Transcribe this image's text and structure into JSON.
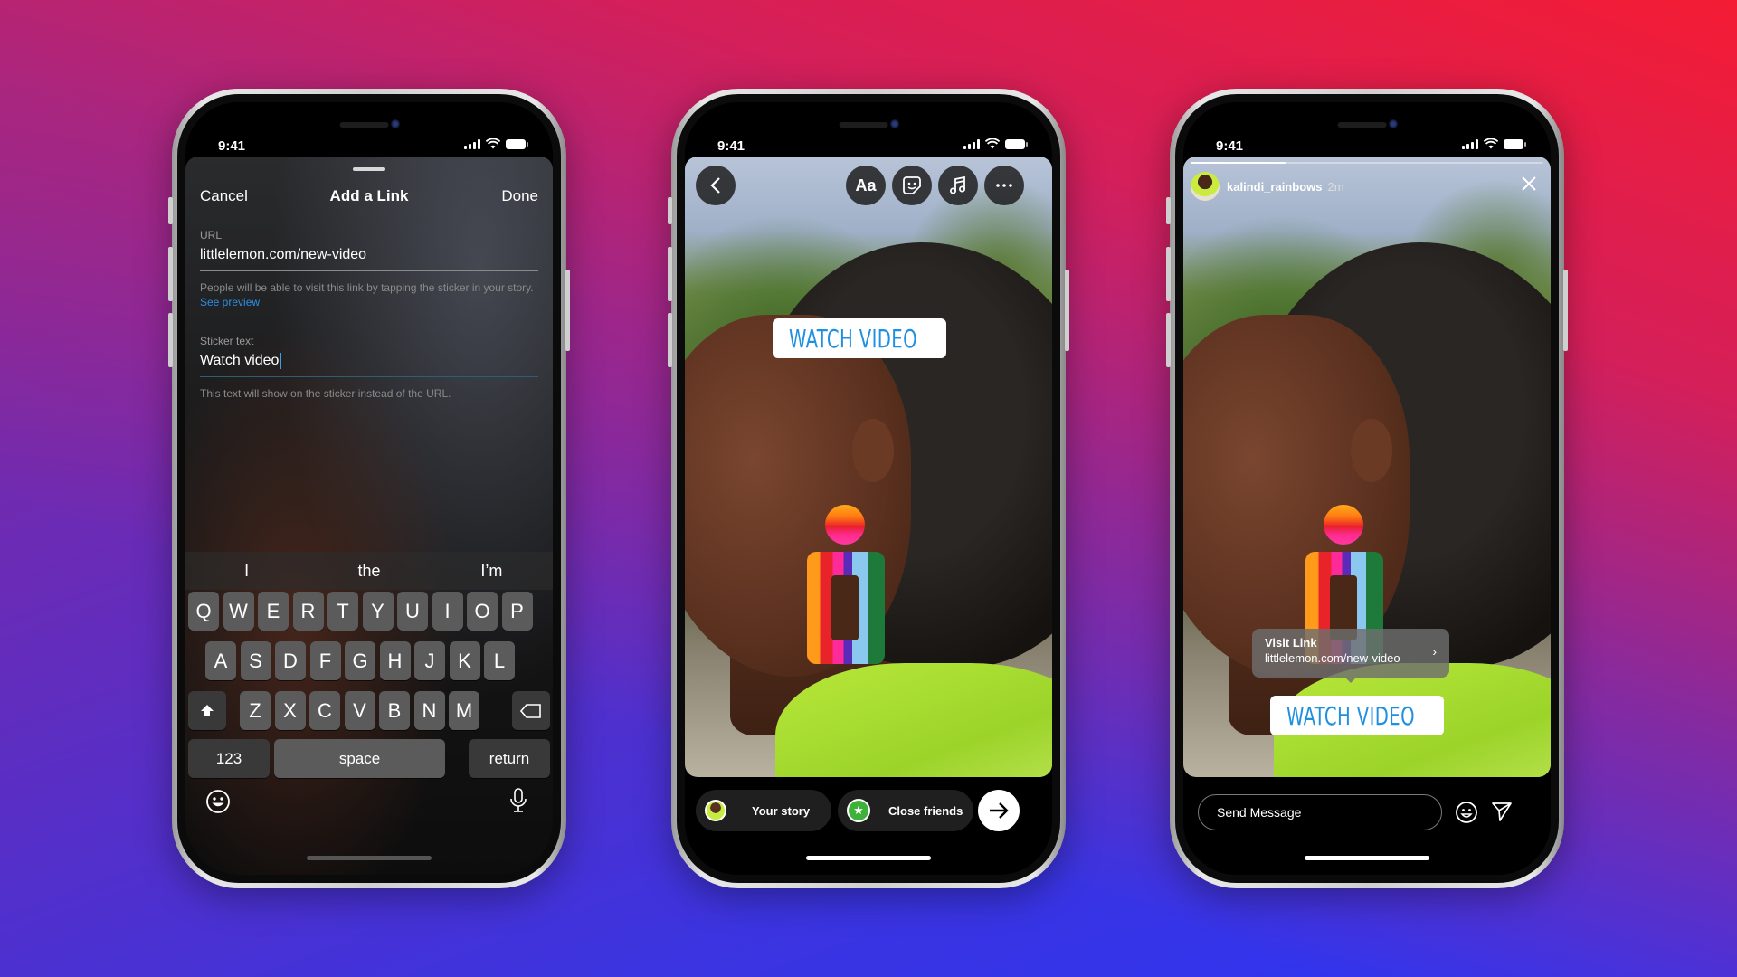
{
  "background": {
    "gradient_colors": [
      "#2c35f5",
      "#6b2bb5",
      "#d41f5a",
      "#f41c34"
    ]
  },
  "status_bar": {
    "time": "9:41"
  },
  "phone1": {
    "sheet": {
      "cancel_label": "Cancel",
      "title": "Add a Link",
      "done_label": "Done"
    },
    "url_field": {
      "label": "URL",
      "value": "littlelemon.com/new-video",
      "help_text": "People will be able to visit this link by tapping the sticker in your story.",
      "help_link": "See preview"
    },
    "sticker_field": {
      "label": "Sticker text",
      "value": "Watch video",
      "help_text": "This text will show on the sticker instead of the URL."
    },
    "suggestions": [
      "I",
      "the",
      "I’m"
    ],
    "keyboard": {
      "row1": [
        "Q",
        "W",
        "E",
        "R",
        "T",
        "Y",
        "U",
        "I",
        "O",
        "P"
      ],
      "row2": [
        "A",
        "S",
        "D",
        "F",
        "G",
        "H",
        "J",
        "K",
        "L"
      ],
      "row3": [
        "Z",
        "X",
        "C",
        "V",
        "B",
        "N",
        "M"
      ],
      "numbers_label": "123",
      "space_label": "space",
      "return_label": "return",
      "shift_icon": "shift-icon",
      "delete_icon": "backspace-icon",
      "emoji_icon": "emoji-icon",
      "mic_icon": "microphone-icon"
    }
  },
  "phone2": {
    "toolbar": {
      "back_icon": "chevron-left-icon",
      "text_label": "Aa",
      "sticker_icon": "sticker-icon",
      "music_icon": "music-note-icon",
      "more_icon": "more-horizontal-icon"
    },
    "link_sticker": {
      "icon": "link-icon",
      "label": "WATCH VIDEO"
    },
    "share": {
      "your_story_label": "Your story",
      "close_friends_label": "Close friends",
      "next_icon": "arrow-right-icon"
    }
  },
  "phone3": {
    "story": {
      "progress": 0.27,
      "username": "kalindi_rainbows",
      "time_ago": "2m",
      "close_icon": "close-icon"
    },
    "visit_link": {
      "title": "Visit Link",
      "url": "littlelemon.com/new-video"
    },
    "link_sticker": {
      "icon": "link-icon",
      "label": "WATCH VIDEO"
    },
    "reply": {
      "placeholder": "Send Message",
      "emoji_icon": "emoji-icon",
      "send_icon": "send-icon"
    }
  },
  "colors": {
    "link_blue": "#1f8fe0",
    "see_preview_blue": "#2a91e4",
    "close_friends_green": "#3db13a",
    "cursor_blue": "#3aa0e8"
  }
}
